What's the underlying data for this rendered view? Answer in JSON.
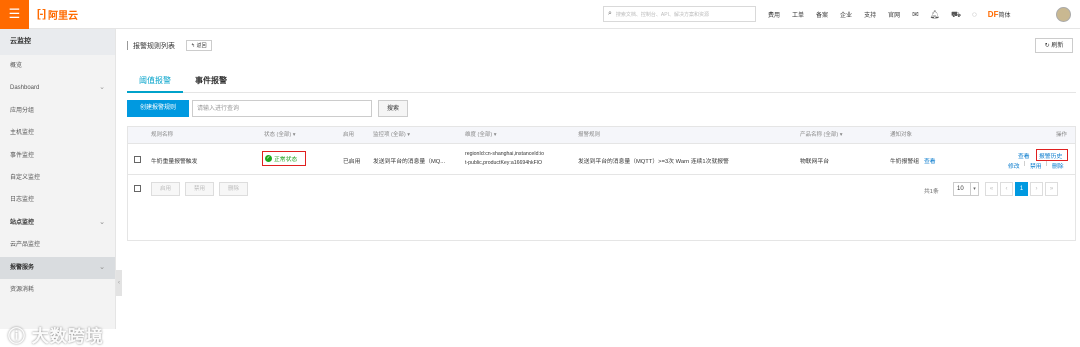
{
  "topbar": {
    "menu_icon": "hamburger-icon",
    "logo_mark": "[-]",
    "logo_text": "阿里云",
    "search_placeholder": "搜索文档、控制台、API、解决方案和资源",
    "nav": [
      "费用",
      "工单",
      "备案",
      "企业",
      "支持",
      "官网"
    ],
    "icons": [
      "mail-icon",
      "bell-icon",
      "cart-icon",
      "help-icon"
    ],
    "user_badge": "DF",
    "user_label": "简体"
  },
  "sidebar": {
    "title": "云监控",
    "items": [
      {
        "label": "概览",
        "group": false
      },
      {
        "label": "Dashboard",
        "group": false,
        "chevron": true
      },
      {
        "label": "应用分组",
        "group": false
      },
      {
        "label": "主机监控",
        "group": false
      },
      {
        "label": "事件监控",
        "group": false
      },
      {
        "label": "自定义监控",
        "group": false
      },
      {
        "label": "日志监控",
        "group": false
      },
      {
        "label": "站点监控",
        "group": true,
        "chevron": true
      },
      {
        "label": "云产品监控",
        "group": false
      },
      {
        "label": "报警服务",
        "group": true,
        "chevron": true,
        "active": true
      },
      {
        "label": "资源消耗",
        "group": false
      }
    ],
    "watermark": "大数跨境"
  },
  "page": {
    "title": "报警规则列表",
    "back_label": "返回",
    "refresh_label": "刷新",
    "tabs": [
      "阈值报警",
      "事件报警"
    ],
    "create_label": "创建报警规则",
    "query_placeholder": "请输入进行查询",
    "search_label": "搜索"
  },
  "table": {
    "headers": [
      "规则名称",
      "状态 (全部) ▾",
      "启用",
      "监控项 (全部) ▾",
      "维度 (全部) ▾",
      "报警规则",
      "产品名称 (全部) ▾",
      "通知对象",
      "操作"
    ],
    "row": {
      "name": "牛奶重量报警触发",
      "status": "正常状态",
      "enabled": "已启用",
      "metric": "发送到平台的消息量（MQ...",
      "dimension_line1": "regionId:cn-shanghai,instanceId:io",
      "dimension_line2": "t-public,productKey:a16694hkFlO",
      "rule": "发送到平台的消息量（MQTT）>=3次 Warn 连续1次就报警",
      "product": "物联网平台",
      "notify": "牛奶报警组",
      "notify_link": "查看",
      "ops_line1": [
        "查看",
        "报警历史"
      ],
      "ops_line2": [
        "修改",
        "禁用",
        "删除"
      ]
    },
    "footer": {
      "actions": [
        "启用",
        "禁用",
        "删除"
      ],
      "total": "共1条",
      "page_size": "10",
      "pager": [
        "«",
        "‹",
        "1",
        "›",
        "»"
      ],
      "current_page": "1"
    }
  }
}
